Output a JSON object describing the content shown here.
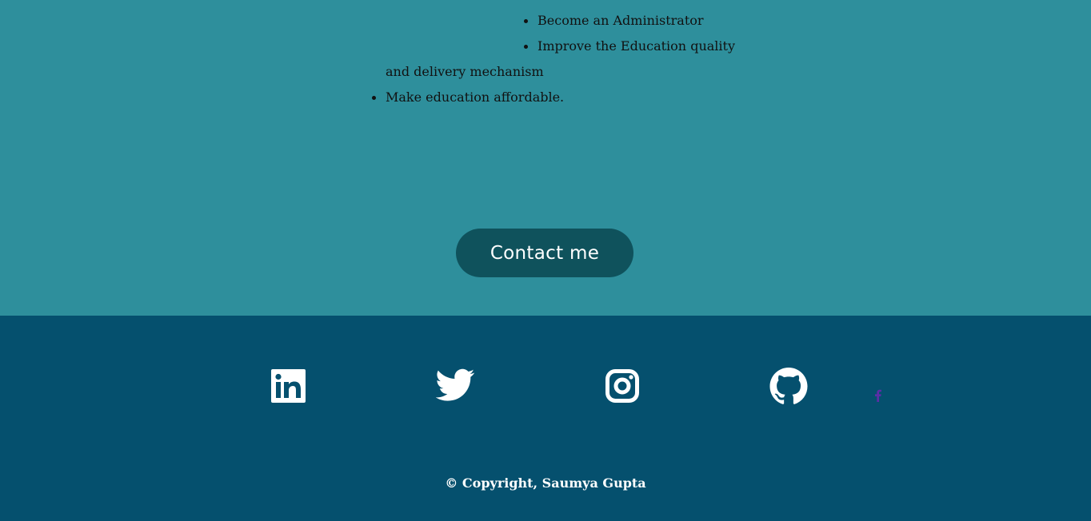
{
  "goals": {
    "inner_items": [
      "Become an Administrator",
      "Improve the Education quality"
    ],
    "continuation": "and delivery mechanism",
    "outer_items": [
      "Make education affordable."
    ]
  },
  "contact": {
    "button_label": "Contact me"
  },
  "footer": {
    "social_icons": [
      "linkedin-icon",
      "twitter-icon",
      "instagram-icon",
      "github-icon",
      "facebook-icon"
    ],
    "copyright": "© Copyright, Saumya Gupta"
  },
  "colors": {
    "top_bg": "#2e8f9c",
    "button_bg": "#0f525c",
    "footer_bg": "#05506e",
    "icon": "#ffffff",
    "facebook_icon": "#5b2ea6"
  }
}
